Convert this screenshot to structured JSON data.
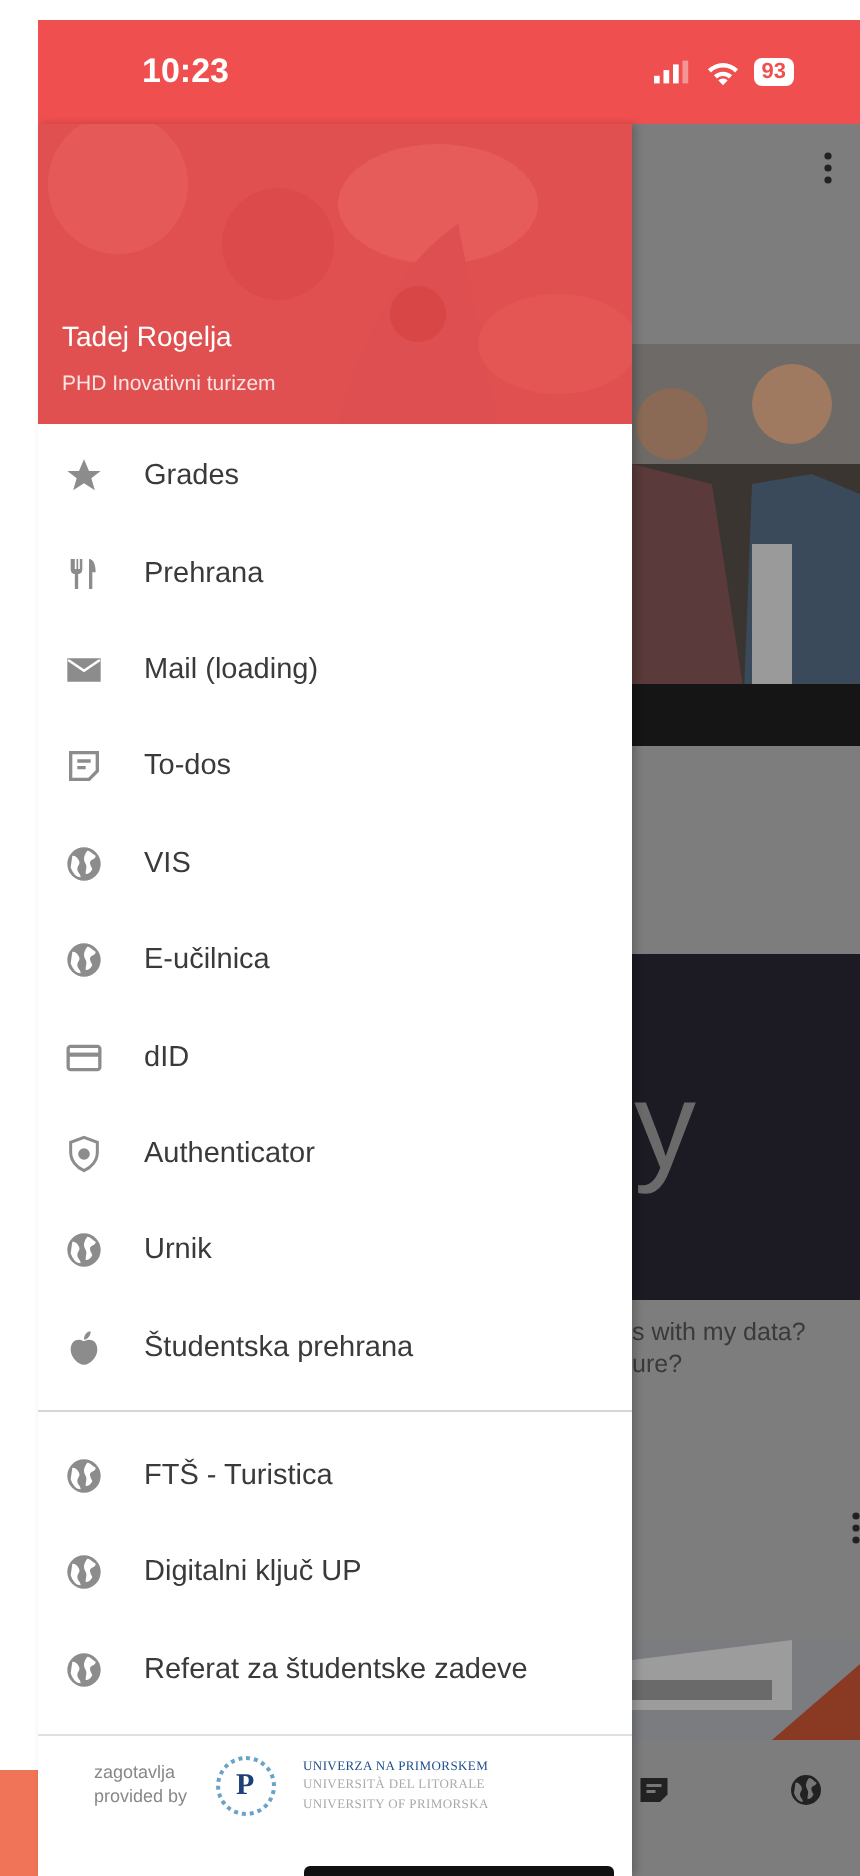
{
  "status_bar": {
    "time": "10:23",
    "battery": "93"
  },
  "drawer": {
    "user_name": "Tadej Rogelja",
    "program": "PHD Inovativni turizem",
    "groups": [
      {
        "items": [
          {
            "label": "Grades",
            "kind": "star"
          },
          {
            "label": "Prehrana",
            "kind": "cutlery"
          },
          {
            "label": "Mail (loading)",
            "kind": "mail"
          },
          {
            "label": "To-dos",
            "kind": "note"
          },
          {
            "label": "VIS",
            "kind": "globe"
          },
          {
            "label": "E-učilnica",
            "kind": "globe"
          },
          {
            "label": "dID",
            "kind": "card"
          },
          {
            "label": "Authenticator",
            "kind": "shield"
          },
          {
            "label": "Urnik",
            "kind": "globe"
          },
          {
            "label": "Študentska prehrana",
            "kind": "apple"
          }
        ]
      },
      {
        "items": [
          {
            "label": "FTŠ - Turistica",
            "kind": "globe"
          },
          {
            "label": "Digitalni ključ UP",
            "kind": "globe"
          },
          {
            "label": "Referat za študentske zadeve",
            "kind": "globe"
          }
        ]
      }
    ],
    "footer": {
      "provided_by": [
        "zagotavlja",
        "provided by"
      ],
      "logo_letter": "P",
      "logo_lines": [
        "UNIVERZA NA PRIMORSKEM",
        "UNIVERSITÀ DEL LITORALE",
        "UNIVERSITY OF PRIMORSKA"
      ]
    }
  },
  "background": {
    "headline_fragment": "y",
    "question_lines": [
      "s with my data?",
      "ure?"
    ]
  }
}
